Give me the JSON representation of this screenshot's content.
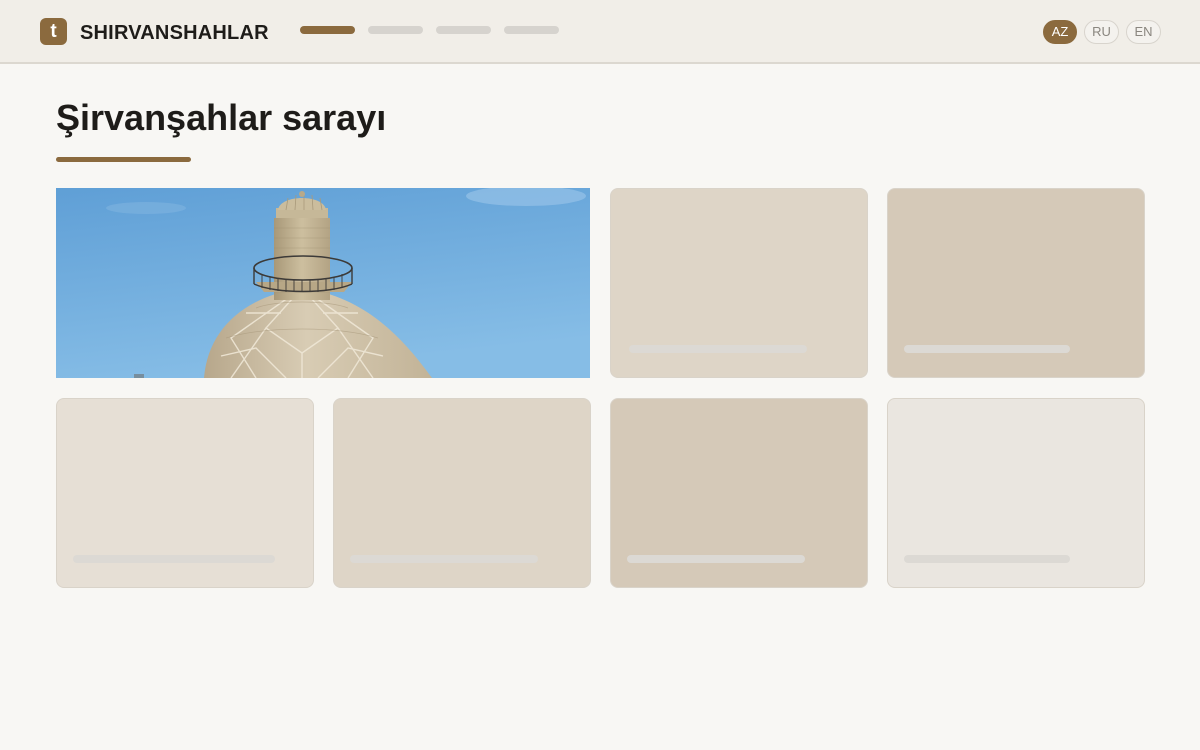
{
  "brand": {
    "logo_letter": "t",
    "name": "SHIRVANSHAHLAR"
  },
  "nav": {
    "items": [
      {
        "state": "active"
      },
      {
        "state": "inactive"
      },
      {
        "state": "inactive"
      },
      {
        "state": "inactive"
      }
    ]
  },
  "languages": [
    {
      "label": "AZ",
      "active": true
    },
    {
      "label": "RU",
      "active": false
    },
    {
      "label": "EN",
      "active": false
    }
  ],
  "page": {
    "title": "Şirvanşahlar sarayı"
  },
  "gallery": {
    "hero": {
      "image": "minaret-and-dome-photo"
    },
    "cards": [
      {
        "color": "#ded5c7"
      },
      {
        "color": "#d5c9b8"
      },
      {
        "color": "#e6dfd5"
      },
      {
        "color": "#ded5c7"
      },
      {
        "color": "#d5c9b8"
      },
      {
        "color": "#eae6e0"
      }
    ]
  },
  "colors": {
    "accent": "#8b6a3e",
    "page_background": "#f8f7f4",
    "header_background": "#f1eee8",
    "placeholder_bar": "#dcd9d4"
  }
}
